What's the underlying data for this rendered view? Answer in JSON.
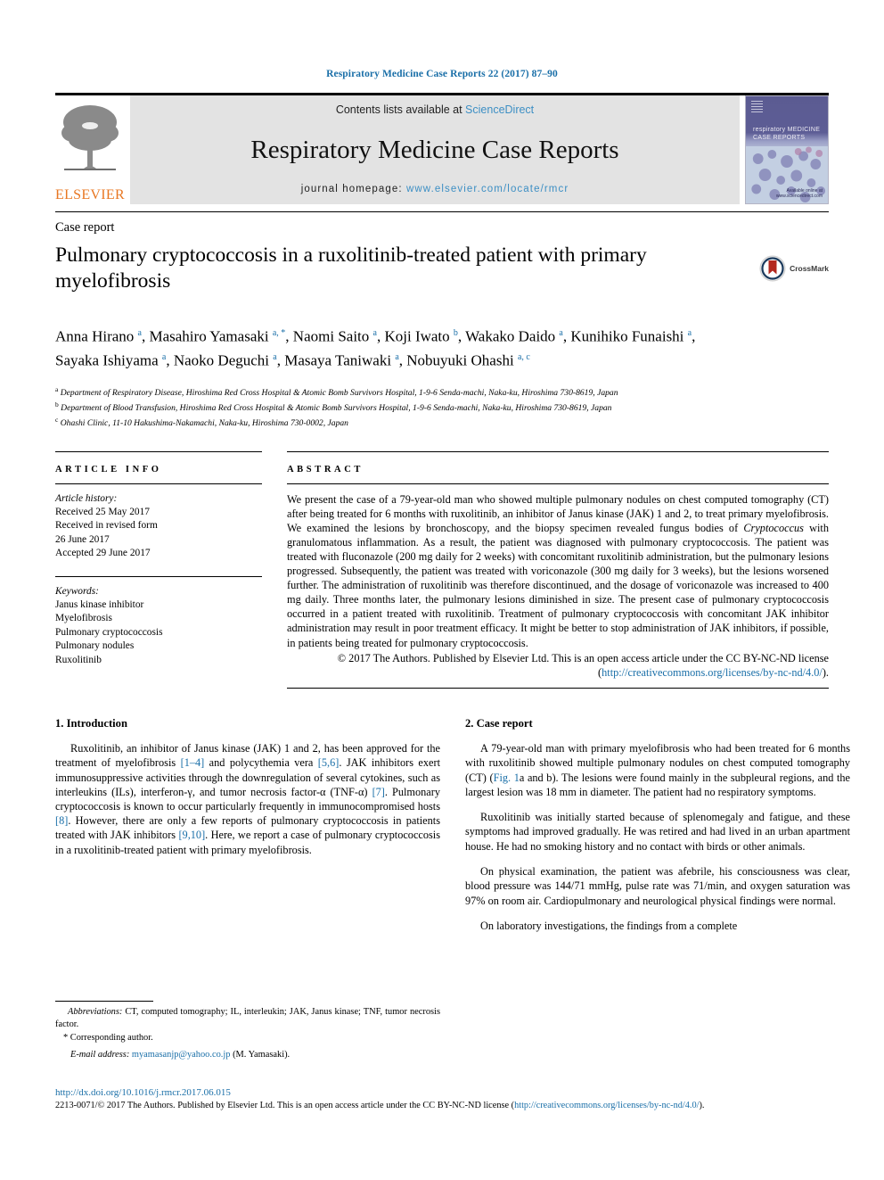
{
  "running_head": "Respiratory Medicine Case Reports 22 (2017) 87–90",
  "masthead": {
    "contents_prefix": "Contents lists available at ",
    "contents_link": "ScienceDirect",
    "journal_title": "Respiratory Medicine Case Reports",
    "homepage_prefix": "journal homepage: ",
    "homepage_link": "www.elsevier.com/locate/rmcr",
    "publisher_wordmark": "ELSEVIER",
    "cover_title_line1": "respiratory MEDICINE",
    "cover_title_line2": "CASE REPORTS",
    "cover_footer": "Available online at\nwww.sciencedirect.com"
  },
  "article": {
    "doctype": "Case report",
    "title": "Pulmonary cryptococcosis in a ruxolitinib-treated patient with primary myelofibrosis",
    "crossmark_label": "CrossMark",
    "authors_html": "Anna Hirano <sup>a</sup>, Masahiro Yamasaki <sup>a, *</sup>, Naomi Saito <sup>a</sup>, Koji Iwato <sup>b</sup>, Wakako Daido <sup>a</sup>, Kunihiko Funaishi <sup>a</sup>, Sayaka Ishiyama <sup>a</sup>, Naoko Deguchi <sup>a</sup>, Masaya Taniwaki <sup>a</sup>, Nobuyuki Ohashi <sup>a, c</sup>",
    "affiliations": [
      {
        "marker": "a",
        "text": "Department of Respiratory Disease, Hiroshima Red Cross Hospital & Atomic Bomb Survivors Hospital, 1-9-6 Senda-machi, Naka-ku, Hiroshima 730-8619, Japan"
      },
      {
        "marker": "b",
        "text": "Department of Blood Transfusion, Hiroshima Red Cross Hospital & Atomic Bomb Survivors Hospital, 1-9-6 Senda-machi, Naka-ku, Hiroshima 730-8619, Japan"
      },
      {
        "marker": "c",
        "text": "Ohashi Clinic, 11-10 Hakushima-Nakamachi, Naka-ku, Hiroshima 730-0002, Japan"
      }
    ]
  },
  "article_info": {
    "heading": "ARTICLE INFO",
    "history_label": "Article history:",
    "history": [
      "Received 25 May 2017",
      "Received in revised form",
      "26 June 2017",
      "Accepted 29 June 2017"
    ],
    "keywords_label": "Keywords:",
    "keywords": [
      "Janus kinase inhibitor",
      "Myelofibrosis",
      "Pulmonary cryptococcosis",
      "Pulmonary nodules",
      "Ruxolitinib"
    ]
  },
  "abstract": {
    "heading": "ABSTRACT",
    "text_html": "We present the case of a 79-year-old man who showed multiple pulmonary nodules on chest computed tomography (CT) after being treated for 6 months with ruxolitinib, an inhibitor of Janus kinase (JAK) 1 and 2, to treat primary myelofibrosis. We examined the lesions by bronchoscopy, and the biopsy specimen revealed fungus bodies of <i>Cryptococcus</i> with granulomatous inflammation. As a result, the patient was diagnosed with pulmonary cryptococcosis. The patient was treated with fluconazole (200 mg daily for 2 weeks) with concomitant ruxolitinib administration, but the pulmonary lesions progressed. Subsequently, the patient was treated with voriconazole (300 mg daily for 3 weeks), but the lesions worsened further. The administration of ruxolitinib was therefore discontinued, and the dosage of voriconazole was increased to 400 mg daily. Three months later, the pulmonary lesions diminished in size. The present case of pulmonary cryptococcosis occurred in a patient treated with ruxolitinib. Treatment of pulmonary cryptococcosis with concomitant JAK inhibitor administration may result in poor treatment efficacy. It might be better to stop administration of JAK inhibitors, if possible, in patients being treated for pulmonary cryptococcosis.",
    "copyright_html": "© 2017 The Authors. Published by Elsevier Ltd. This is an open access article under the CC BY-NC-ND license (<a href=\"#\">http://creativecommons.org/licenses/by-nc-nd/4.0/</a>)."
  },
  "sections": {
    "introduction": {
      "heading": "1. Introduction",
      "paragraph_html": "Ruxolitinib, an inhibitor of Janus kinase (JAK) 1 and 2, has been approved for the treatment of myelofibrosis <span class=\"ref\">[1–4]</span> and polycythemia vera <span class=\"ref\">[5,6]</span>. JAK inhibitors exert immunosuppressive activities through the downregulation of several cytokines, such as interleukins (ILs), interferon-γ, and tumor necrosis factor-α (TNF-α) <span class=\"ref\">[7]</span>. Pulmonary cryptococcosis is known to occur particularly frequently in immunocompromised hosts <span class=\"ref\">[8]</span>. However, there are only a few reports of pulmonary cryptococcosis in patients treated with JAK inhibitors <span class=\"ref\">[9,10]</span>. Here, we report a case of pulmonary cryptococcosis in a ruxolitinib-treated patient with primary myelofibrosis."
    },
    "case_report": {
      "heading": "2. Case report",
      "paragraphs_html": [
        "A 79-year-old man with primary myelofibrosis who had been treated for 6 months with ruxolitinib showed multiple pulmonary nodules on chest computed tomography (CT) (<span class=\"ref\">Fig. 1</span>a and b). The lesions were found mainly in the subpleural regions, and the largest lesion was 18 mm in diameter. The patient had no respiratory symptoms.",
        "Ruxolitinib was initially started because of splenomegaly and fatigue, and these symptoms had improved gradually. He was retired and had lived in an urban apartment house. He had no smoking history and no contact with birds or other animals.",
        "On physical examination, the patient was afebrile, his consciousness was clear, blood pressure was 144/71 mmHg, pulse rate was 71/min, and oxygen saturation was 97% on room air. Cardiopulmonary and neurological physical findings were normal.",
        "On laboratory investigations, the findings from a complete"
      ]
    }
  },
  "footnotes": {
    "abbreviations_html": "<i>Abbreviations:</i> CT, computed tomography; IL, interleukin; JAK, Janus kinase; TNF, tumor necrosis factor.",
    "corresponding": "* Corresponding author.",
    "email_html": "<i>E-mail address:</i> <a href=\"#\">myamasanjp@yahoo.co.jp</a> (M. Yamasaki)."
  },
  "bottom": {
    "doi": "http://dx.doi.org/10.1016/j.rmcr.2017.06.015",
    "issn_html": "2213-0071/© 2017 The Authors. Published by Elsevier Ltd. This is an open access article under the CC BY-NC-ND license (<a href=\"#\">http://creativecommons.org/licenses/by-nc-nd/4.0/</a>)."
  },
  "colors": {
    "link_blue": "#1a6fa8",
    "sciencedirect_blue": "#3d8fc4",
    "elsevier_orange": "#E87722",
    "band_gray": "#e3e3e3",
    "crossmark_red": "#b3281e"
  }
}
